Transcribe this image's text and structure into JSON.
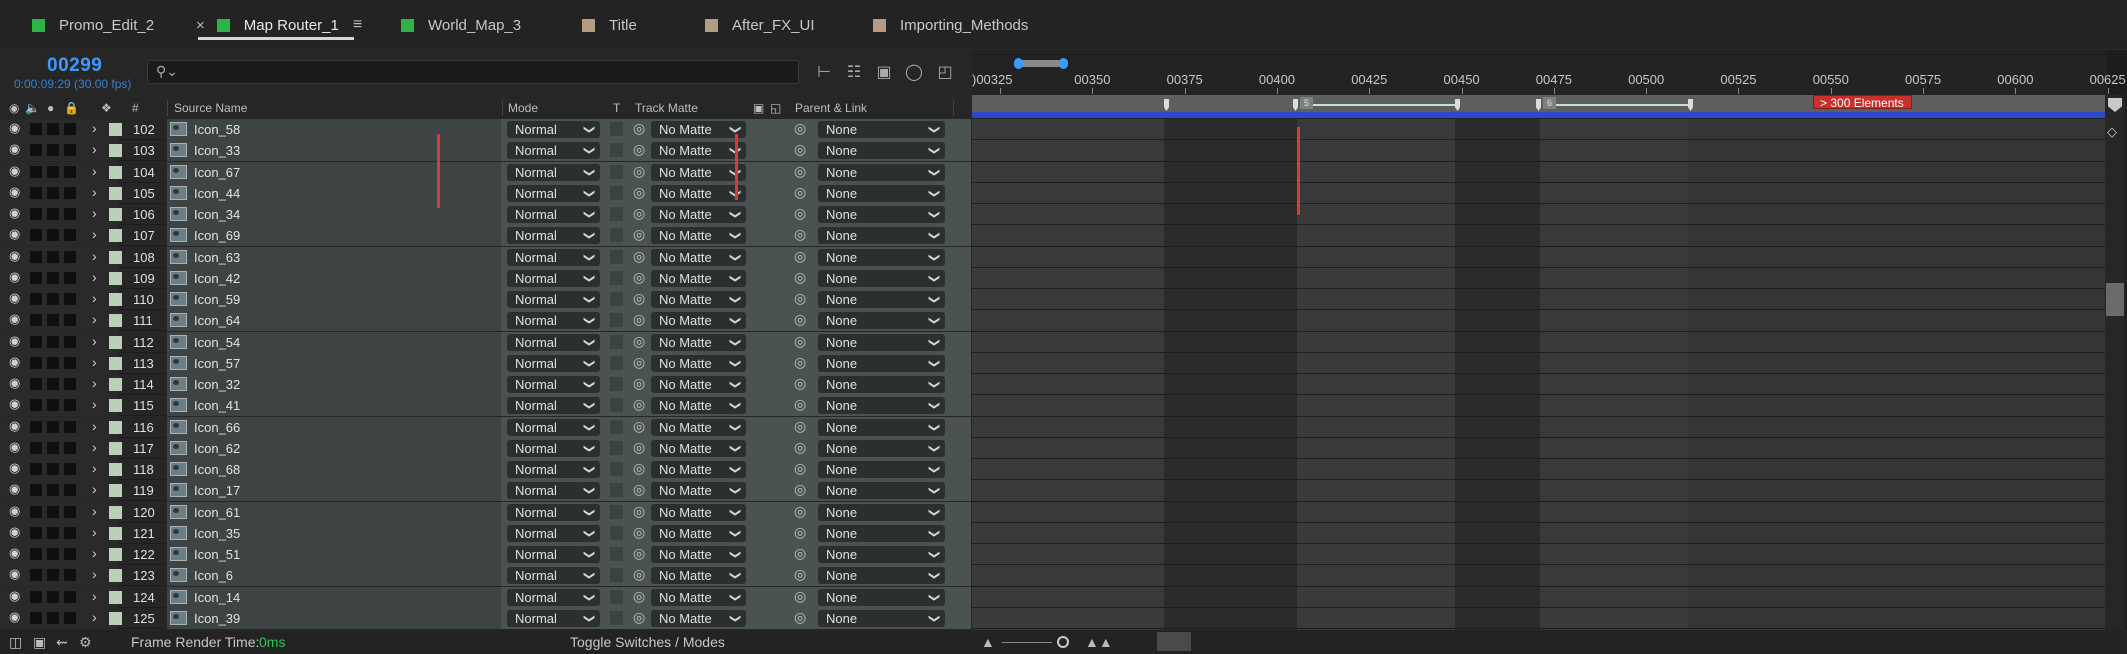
{
  "tabs": [
    {
      "label": "Promo_Edit_2",
      "color": "#2fb24a"
    },
    {
      "label": "Map Router_1",
      "color": "#2fb24a",
      "active": true
    },
    {
      "label": "World_Map_3",
      "color": "#2fb24a"
    },
    {
      "label": "Title",
      "color": "#b29c82"
    },
    {
      "label": "After_FX_UI",
      "color": "#b29c82"
    },
    {
      "label": "Importing_Methods",
      "color": "#b29c82"
    }
  ],
  "tab_close": "×",
  "tab_menu": "≡",
  "timecode": "00299",
  "timecode_sub": "0:00:09:29 (30.00 fps)",
  "search": {
    "icon": "search-icon",
    "placeholder": ""
  },
  "columns": {
    "number": "#",
    "source_name": "Source Name",
    "mode": "Mode",
    "t": "T",
    "track_matte": "Track Matte",
    "parent_link": "Parent & Link"
  },
  "layers": [
    {
      "num": "102",
      "name": "Icon_58"
    },
    {
      "num": "103",
      "name": "Icon_33"
    },
    {
      "num": "104",
      "name": "Icon_67"
    },
    {
      "num": "105",
      "name": "Icon_44"
    },
    {
      "num": "106",
      "name": "Icon_34"
    },
    {
      "num": "107",
      "name": "Icon_69"
    },
    {
      "num": "108",
      "name": "Icon_63"
    },
    {
      "num": "109",
      "name": "Icon_42"
    },
    {
      "num": "110",
      "name": "Icon_59"
    },
    {
      "num": "111",
      "name": "Icon_64"
    },
    {
      "num": "112",
      "name": "Icon_54"
    },
    {
      "num": "113",
      "name": "Icon_57"
    },
    {
      "num": "114",
      "name": "Icon_32"
    },
    {
      "num": "115",
      "name": "Icon_41"
    },
    {
      "num": "116",
      "name": "Icon_66"
    },
    {
      "num": "117",
      "name": "Icon_62"
    },
    {
      "num": "118",
      "name": "Icon_68"
    },
    {
      "num": "119",
      "name": "Icon_17"
    },
    {
      "num": "120",
      "name": "Icon_61"
    },
    {
      "num": "121",
      "name": "Icon_35"
    },
    {
      "num": "122",
      "name": "Icon_51"
    },
    {
      "num": "123",
      "name": "Icon_6"
    },
    {
      "num": "124",
      "name": "Icon_14"
    },
    {
      "num": "125",
      "name": "Icon_39"
    }
  ],
  "row_defaults": {
    "mode": "Normal",
    "track_matte": "No Matte",
    "parent": "None"
  },
  "ruler_ticks": [
    "00325",
    "00350",
    "00375",
    "00400",
    "00425",
    "00450",
    "00475",
    "00500",
    "00525",
    "00550",
    "00575",
    "00600",
    "00625"
  ],
  "ruler_tick_prefix": ")",
  "work_markers": {
    "tag_5": "5",
    "tag_6": "6"
  },
  "red_tag": "> 300 Elements",
  "footer": {
    "frame_render_label": "Frame Render Time:",
    "frame_render_value": "0ms",
    "toggle_label": "Toggle Switches / Modes"
  },
  "colors": {
    "accent": "#3d9bff",
    "ok": "#35c35c",
    "alert": "#c8302c"
  }
}
